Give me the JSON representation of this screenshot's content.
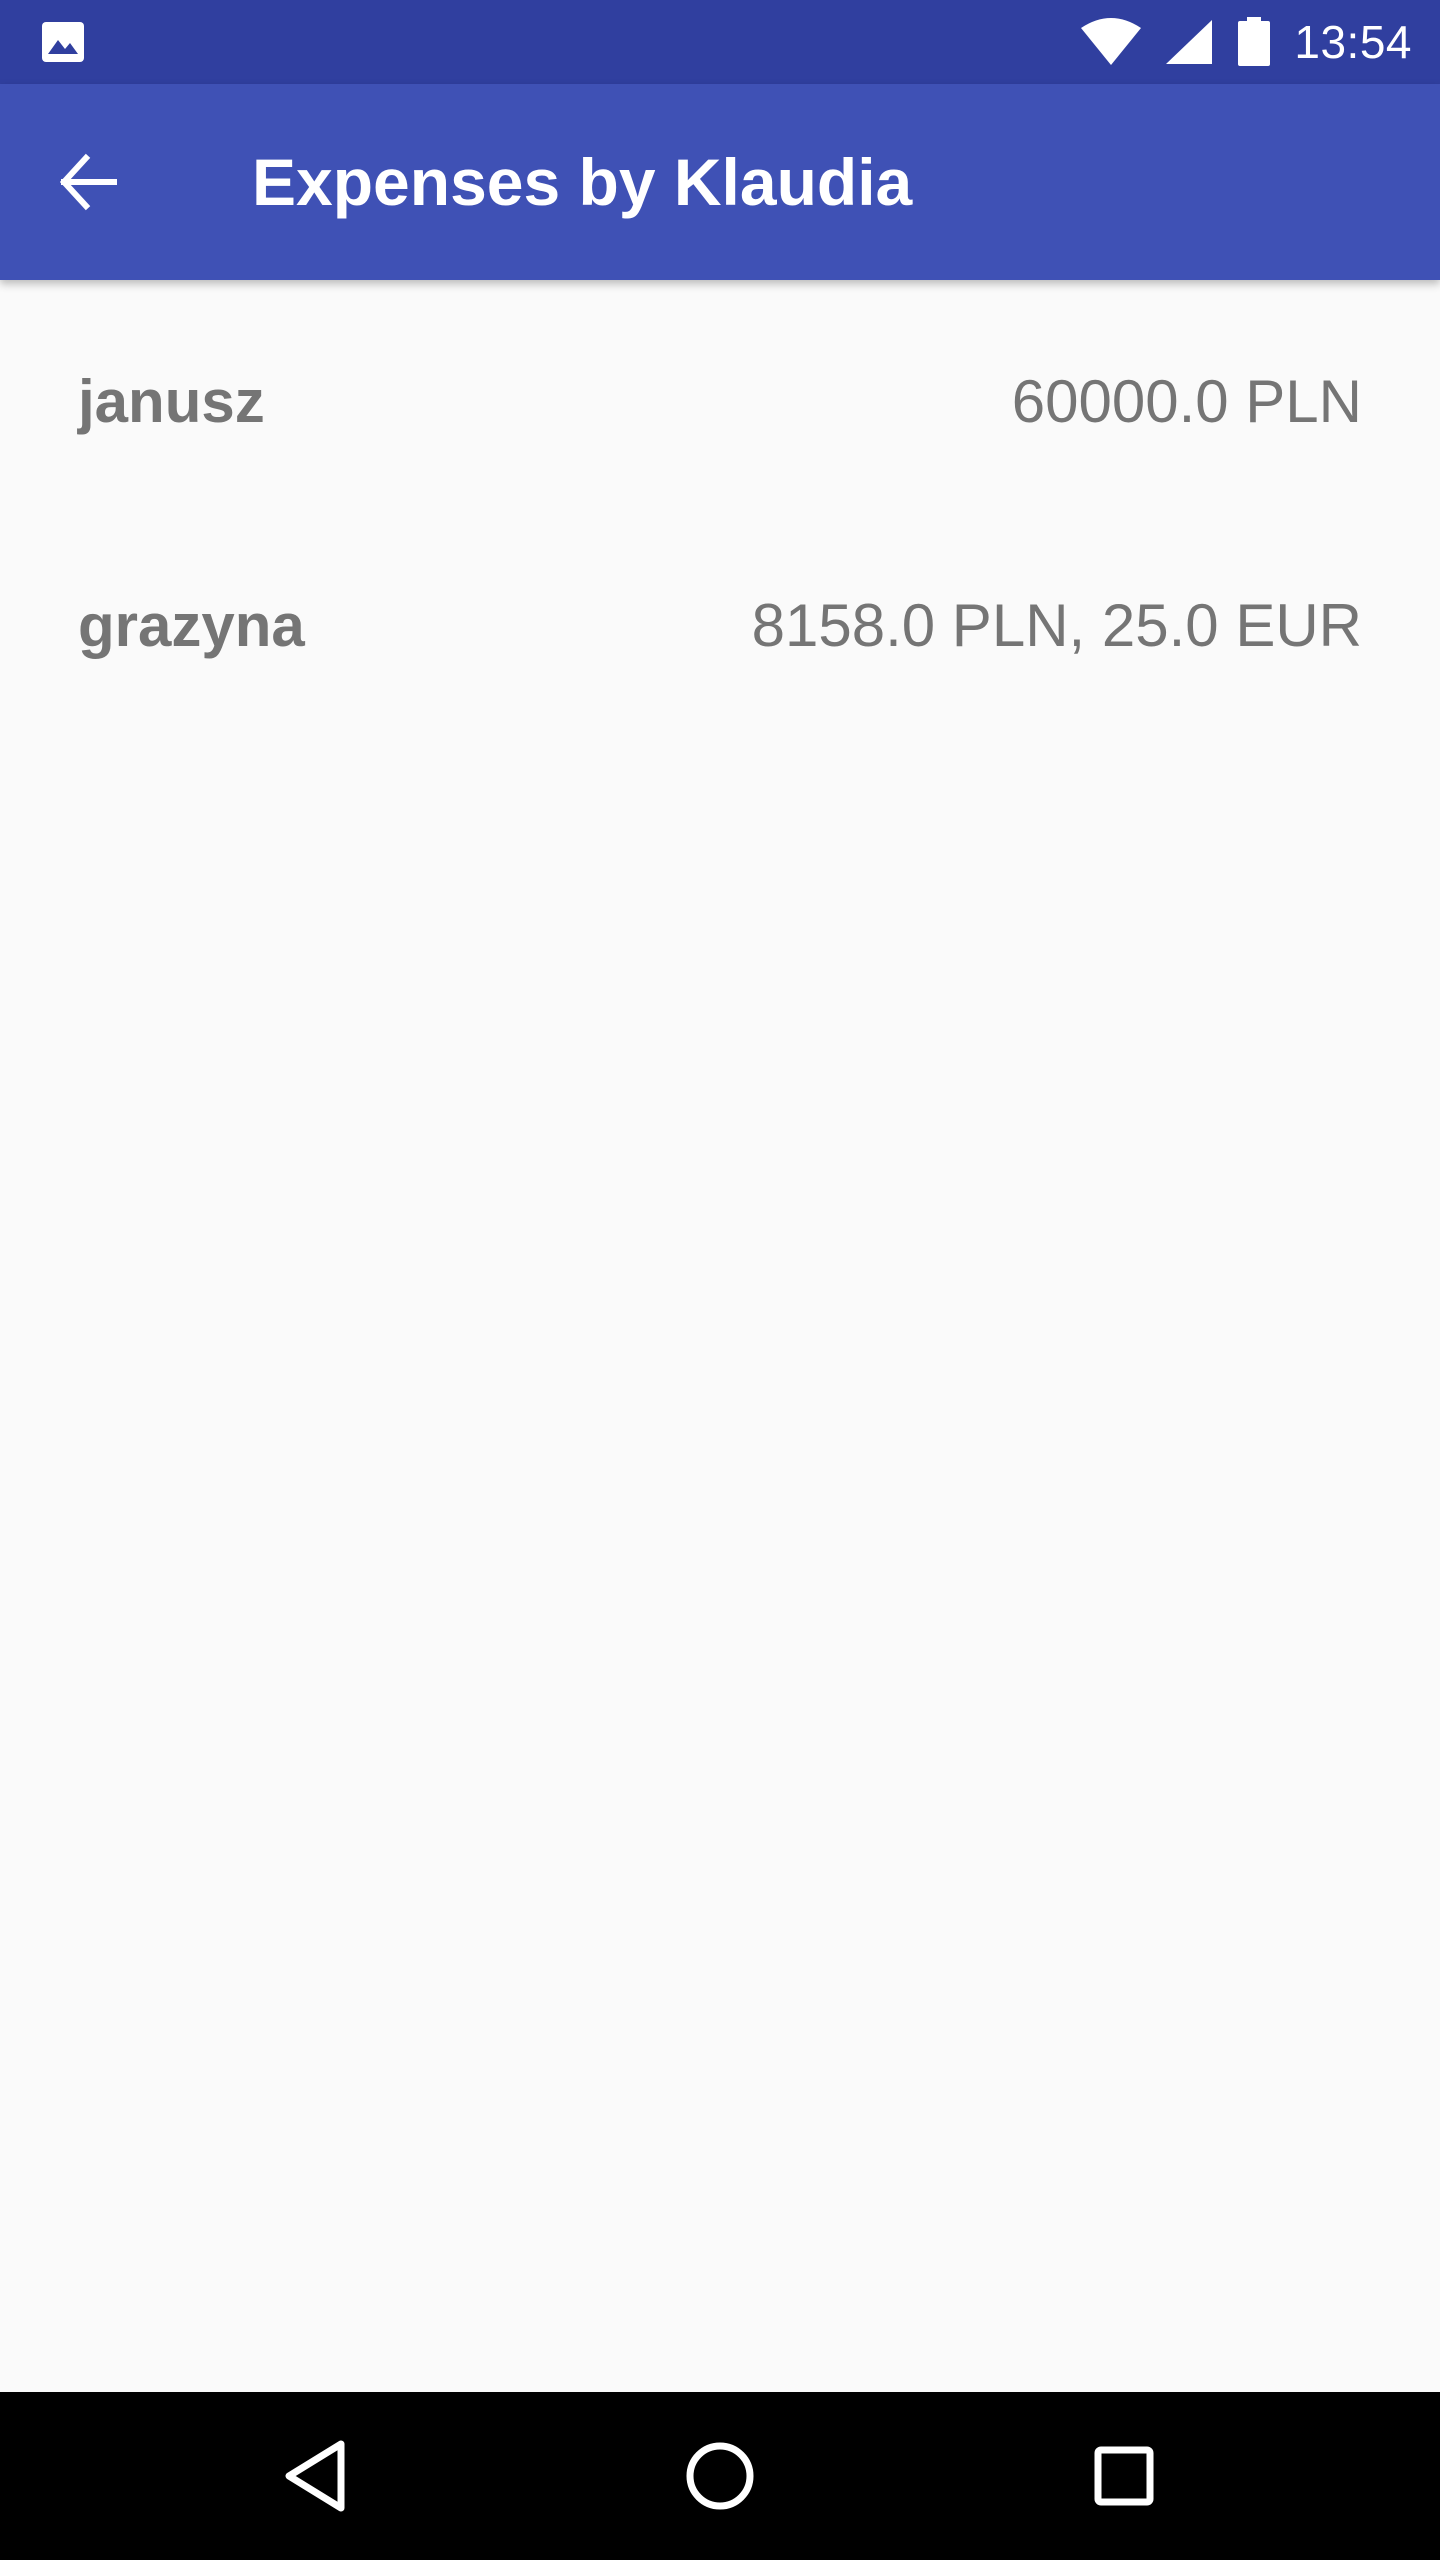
{
  "status_bar": {
    "time": "13:54",
    "left_icon": "image-notification-icon",
    "icons": [
      "wifi-icon",
      "cellular-signal-icon",
      "battery-icon"
    ]
  },
  "app_bar": {
    "title": "Expenses by Klaudia",
    "back_icon": "arrow-back-icon",
    "background": "#3f51b5",
    "status_background": "#303f9f"
  },
  "expenses": [
    {
      "name": "janusz",
      "amount": "60000.0 PLN"
    },
    {
      "name": "grazyna",
      "amount": "8158.0 PLN, 25.0 EUR"
    }
  ],
  "nav_bar": {
    "buttons": [
      "back-triangle-icon",
      "home-circle-icon",
      "recents-square-icon"
    ]
  }
}
